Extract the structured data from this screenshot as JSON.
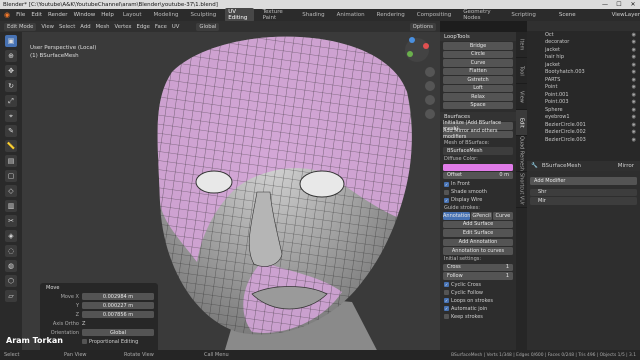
{
  "titlebar": {
    "text": "Blender* [C:\\Youtube\\A&K\\YoutubeChannel\\aram\\Blender\\youtube-37\\1.blend]",
    "min": "—",
    "max": "☐",
    "close": "✕"
  },
  "menubar": {
    "items": [
      "File",
      "Edit",
      "Render",
      "Window",
      "Help"
    ],
    "workspaces": [
      "Layout",
      "Modeling",
      "Sculpting",
      "UV Editing",
      "Texture Paint",
      "Shading",
      "Animation",
      "Rendering",
      "Compositing",
      "Geometry Nodes",
      "Scripting"
    ],
    "active_ws": "UV Editing",
    "scene": "Scene",
    "view_layer": "ViewLayer"
  },
  "header": {
    "mode": "Edit Mode",
    "items": [
      "View",
      "Select",
      "Add",
      "Mesh",
      "Vertex",
      "Edge",
      "Face",
      "UV"
    ],
    "transform": "Global",
    "options": "Options"
  },
  "viewport": {
    "title": "User Perspective (Local)",
    "object": "(1) BSurfaceMesh"
  },
  "looptools": {
    "title": "LoopTools",
    "buttons": [
      "Bridge",
      "Circle",
      "Curve",
      "Flatten",
      "Gstretch",
      "Loft",
      "Relax",
      "Space"
    ]
  },
  "bsurfaces": {
    "title": "Bsurfaces",
    "init_btn": "Initialize (Add BSurface mesh)",
    "add_mod_btn": "Add Mirror and others modifiers",
    "mesh_label": "Mesh of BSurface:",
    "mesh_name": "BSurfaceMesh",
    "diffuse_label": "Diffuse Color:",
    "offset_label": "Offset",
    "offset_val": "0 m",
    "in_front": "In Front",
    "shade_smooth": "Shade smooth",
    "display_wire": "Display Wire",
    "guide_label": "Guide strokes:",
    "guide_opts": [
      "Annotation",
      "GPencil",
      "Curve"
    ],
    "add_surface": "Add Surface",
    "edit_surface": "Edit Surface",
    "add_annotation": "Add Annotation",
    "annotation_to_curves": "Annotation to curves",
    "initial_settings": "Initial settings:",
    "cross_label": "Cross",
    "cross_val": "1",
    "follow_label": "Follow",
    "follow_val": "1",
    "cyclic_cross": "Cyclic Cross",
    "cyclic_follow": "Cyclic Follow",
    "loops_on_strokes": "Loops on strokes",
    "automatic_join": "Automatic join",
    "keep_strokes": "Keep strokes"
  },
  "sidetabs": [
    "Item",
    "Tool",
    "View",
    "Edit",
    "Quad Remesh",
    "Shortcut VUr"
  ],
  "outliner": {
    "rows": [
      "Oct",
      "decorator",
      "jacket",
      "hair hip",
      "jacket",
      "Bootyhatch.003",
      "PARTS",
      "Point",
      "Point.001",
      "Point.003",
      "Sphere",
      "eyebrow1",
      "BezierCircle.001",
      "BezierCircle.002",
      "BezierCircle.003"
    ]
  },
  "properties": {
    "object": "BSurfaceMesh",
    "modifier_obj": "Mirror",
    "add_modifier": "Add Modifier",
    "modifiers": [
      "Shr",
      "Mir"
    ]
  },
  "operator": {
    "title": "Move",
    "move_x": "0.002984 m",
    "move_y": "0.000227 m",
    "move_z": "0.007856 m",
    "axis_ortho": "Z",
    "orientation": "Global",
    "prop_edit": "Proportional Editing"
  },
  "statusbar": {
    "left": [
      "Select",
      "Pan View",
      "Rotate View",
      "Call Menu"
    ],
    "right": "BSurfaceMesh | Verts 1/348 | Edges 0/600 | Faces 0/248 | Tris 496 | Objects 1/5 | 3.1"
  },
  "watermark": "Aram Torkan",
  "colors": {
    "accent": "#4772b3",
    "mesh_pink": "#d2a3d6",
    "bg": "#3a3a3a"
  }
}
